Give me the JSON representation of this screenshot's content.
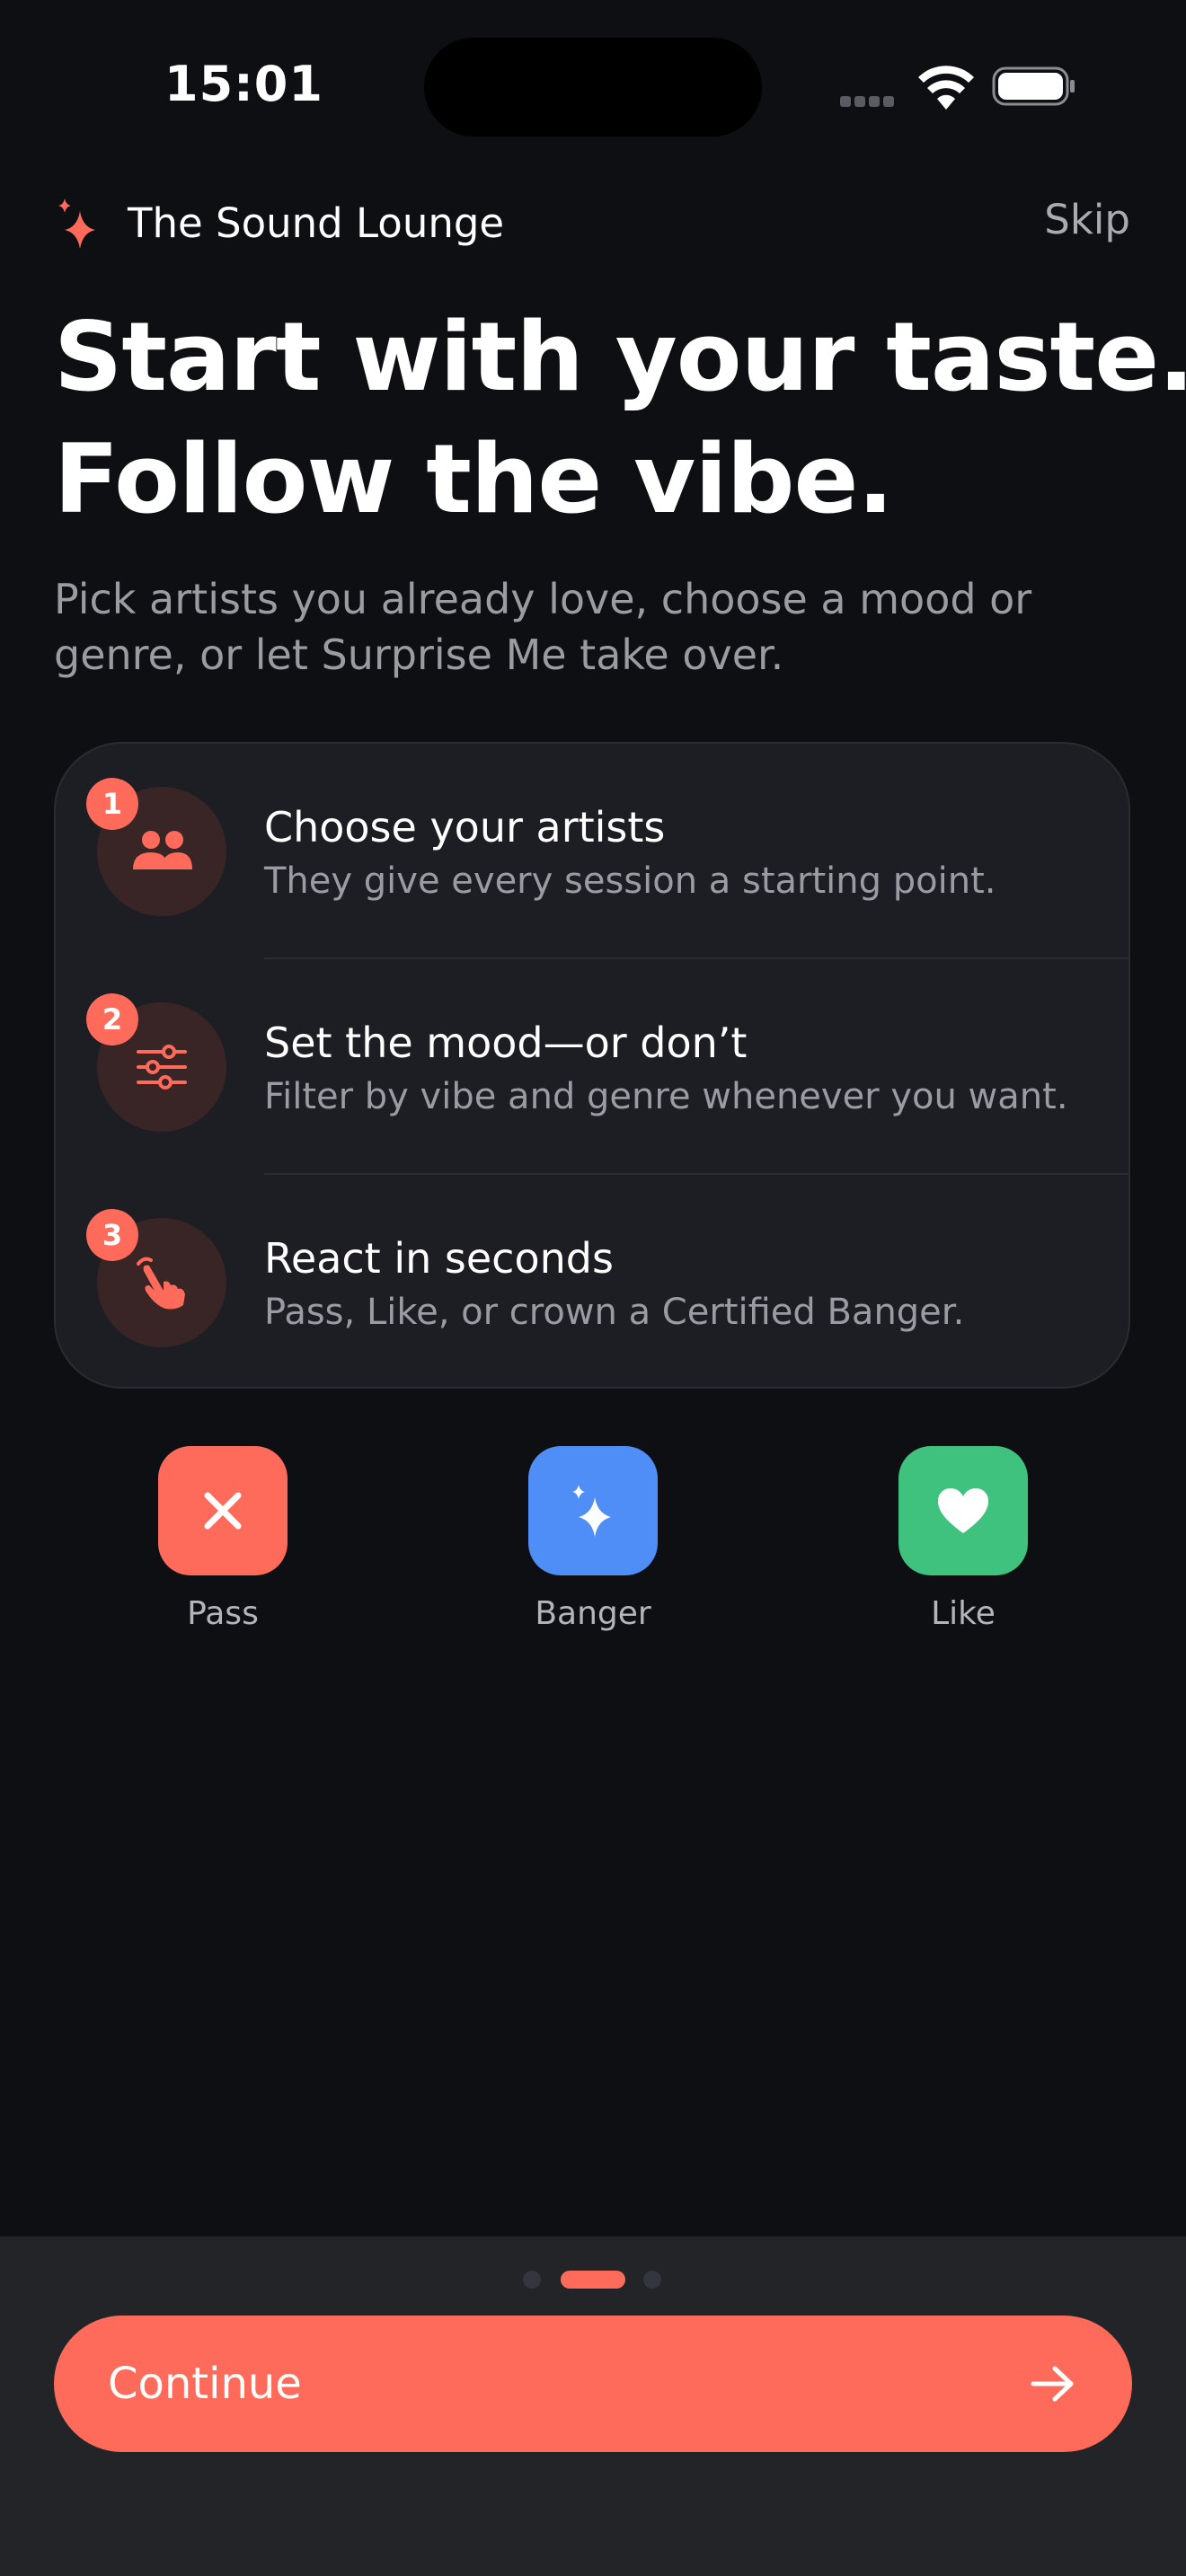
{
  "status_bar": {
    "time": "15:01"
  },
  "header": {
    "app_name": "The Sound Lounge",
    "skip_label": "Skip"
  },
  "hero": {
    "headline_line1": "Start with your taste.",
    "headline_line2": "Follow the vibe.",
    "subtitle": "Pick artists you already love, choose a mood or genre, or let Surprise Me take over."
  },
  "steps": [
    {
      "number": "1",
      "icon": "people-icon",
      "title": "Choose your artists",
      "description": "They give every session a starting point."
    },
    {
      "number": "2",
      "icon": "sliders-icon",
      "title": "Set the mood—or don’t",
      "description": "Filter by vibe and genre whenever you want."
    },
    {
      "number": "3",
      "icon": "tap-hand-icon",
      "title": "React in seconds",
      "description": "Pass, Like, or crown a Certified Banger."
    }
  ],
  "actions": [
    {
      "label": "Pass",
      "icon": "close-icon",
      "color": "#ff6b5b"
    },
    {
      "label": "Banger",
      "icon": "sparkle-icon",
      "color": "#4f8ef7"
    },
    {
      "label": "Like",
      "icon": "heart-icon",
      "color": "#3ec27d"
    }
  ],
  "pagination": {
    "total": 3,
    "current": 2
  },
  "footer": {
    "continue_label": "Continue"
  },
  "colors": {
    "accent": "#ff6b5b",
    "background": "#0e0f12",
    "card": "#1c1e24",
    "bottom_bar": "#232427"
  }
}
